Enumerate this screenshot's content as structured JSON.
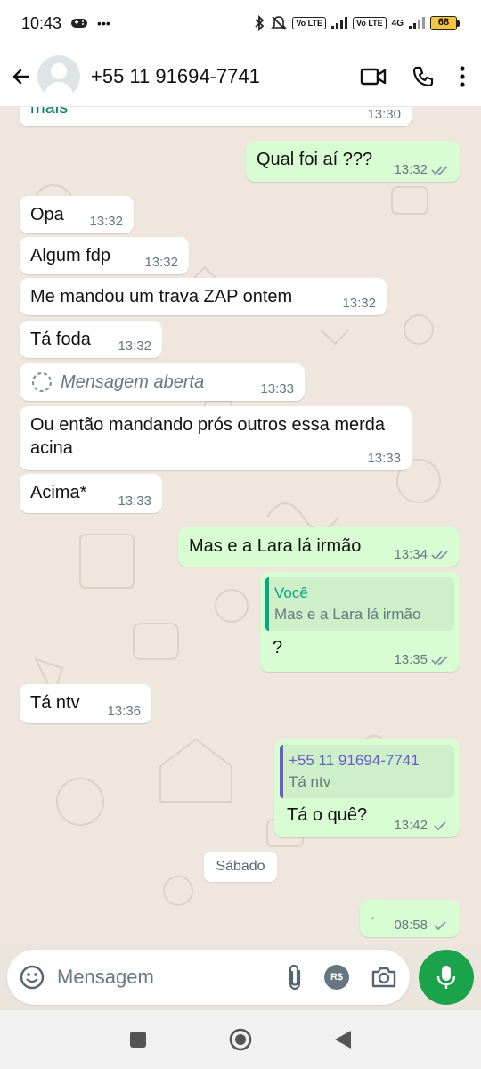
{
  "status_bar": {
    "time": "10:43",
    "dots": "•••",
    "volte1": "Vo LTE",
    "volte2": "Vo LTE",
    "network": "4G",
    "battery": "68"
  },
  "header": {
    "contact": "+55 11 91694-7741"
  },
  "messages": [
    {
      "dir": "in",
      "text": "mais",
      "time": "13:30"
    },
    {
      "dir": "out",
      "text": "Qual foi aí ???",
      "time": "13:32"
    },
    {
      "dir": "in",
      "text": "Opa",
      "time": "13:32"
    },
    {
      "dir": "in",
      "text": "Algum fdp",
      "time": "13:32"
    },
    {
      "dir": "in",
      "text": "Me mandou um trava ZAP ontem",
      "time": "13:32"
    },
    {
      "dir": "in",
      "text": "Tá foda",
      "time": "13:32"
    },
    {
      "dir": "in",
      "text": "Mensagem aberta",
      "time": "13:33"
    },
    {
      "dir": "in",
      "text": "Ou então mandando prós outros essa merda acina",
      "time": "13:33"
    },
    {
      "dir": "in",
      "text": "Acima*",
      "time": "13:33"
    },
    {
      "dir": "out",
      "text": "Mas e a Lara lá irmão",
      "time": "13:34"
    },
    {
      "dir": "out",
      "quote_author": "Você",
      "quote_text": "Mas e a Lara lá irmão",
      "text": "?",
      "time": "13:35"
    },
    {
      "dir": "in",
      "text": "Tá ntv",
      "time": "13:36"
    },
    {
      "dir": "out",
      "quote_author": "+55 11 91694-7741",
      "quote_text": "Tá ntv",
      "text": "Tá o quê?",
      "time": "13:42"
    },
    {
      "dir": "out",
      "text": "·",
      "time": "08:58"
    }
  ],
  "date_divider": "Sábado",
  "composer": {
    "placeholder": "Mensagem",
    "currency": "R$"
  },
  "colors": {
    "incoming": "#ffffff",
    "outgoing": "#d9fdd3",
    "accent": "#1aa34a",
    "quote_self": "#06a884",
    "quote_contact": "#6b5bd2"
  }
}
